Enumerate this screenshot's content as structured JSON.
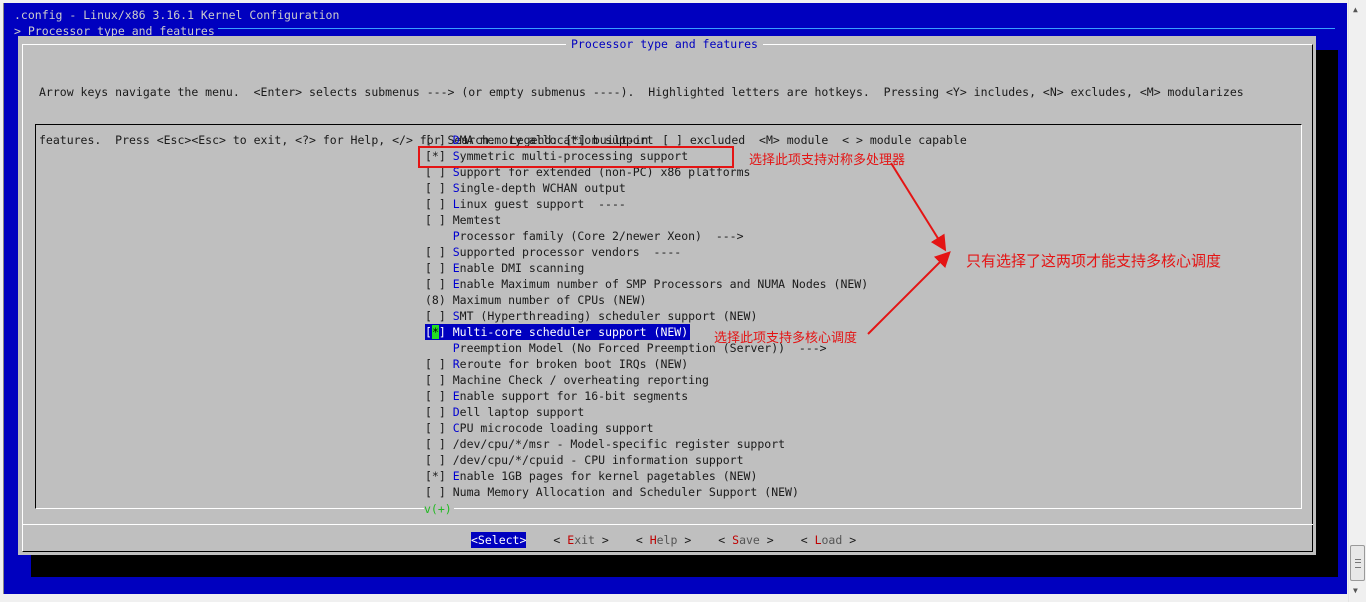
{
  "window": {
    "title": ".config - Linux/x86 3.16.1 Kernel Configuration",
    "breadcrumb": "> Processor type and features "
  },
  "dialog": {
    "title": "Processor type and features",
    "help_lines": [
      "Arrow keys navigate the menu.  <Enter> selects submenus ---> (or empty submenus ----).  Highlighted letters are hotkeys.  Pressing <Y> includes, <N> excludes, <M> modularizes",
      "features.  Press <Esc><Esc> to exit, <?> for Help, </> for Search.  Legend: [*] built-in  [ ] excluded  <M> module  < > module capable"
    ]
  },
  "menu": {
    "items": [
      {
        "state": "[ ]",
        "hotkey": "D",
        "rest": "MA memory allocation support",
        "selected": false
      },
      {
        "state": "[*]",
        "hotkey": "S",
        "rest": "ymmetric multi-processing support",
        "selected": false
      },
      {
        "state": "[ ]",
        "hotkey": "S",
        "rest": "upport for extended (non-PC) x86 platforms",
        "selected": false
      },
      {
        "state": "[ ]",
        "hotkey": "S",
        "rest": "ingle-depth WCHAN output",
        "selected": false
      },
      {
        "state": "[ ]",
        "hotkey": "L",
        "rest": "inux guest support  ----",
        "selected": false
      },
      {
        "state": "[ ]",
        "hotkey": "",
        "rest": "Memtest",
        "selected": false
      },
      {
        "state": "   ",
        "hotkey": "P",
        "rest": "rocessor family (Core 2/newer Xeon)  --->",
        "selected": false
      },
      {
        "state": "[ ]",
        "hotkey": "S",
        "rest": "upported processor vendors  ----",
        "selected": false
      },
      {
        "state": "[ ]",
        "hotkey": "E",
        "rest": "nable DMI scanning",
        "selected": false
      },
      {
        "state": "[ ]",
        "hotkey": "E",
        "rest": "nable Maximum number of SMP Processors and NUMA Nodes (NEW)",
        "selected": false
      },
      {
        "state": "(8)",
        "hotkey": "",
        "rest": "Maximum number of CPUs (NEW)",
        "selected": false
      },
      {
        "state": "[ ]",
        "hotkey": "S",
        "rest": "MT (Hyperthreading) scheduler support (NEW)",
        "selected": false
      },
      {
        "state": "[*]",
        "hotkey": "",
        "rest": "Multi-core scheduler support (NEW)",
        "selected": true
      },
      {
        "state": "   ",
        "hotkey": "P",
        "rest": "reemption Model (No Forced Preemption (Server))  --->",
        "selected": false
      },
      {
        "state": "[ ]",
        "hotkey": "R",
        "rest": "eroute for broken boot IRQs (NEW)",
        "selected": false
      },
      {
        "state": "[ ]",
        "hotkey": "",
        "rest": "Machine Check / overheating reporting",
        "selected": false
      },
      {
        "state": "[ ]",
        "hotkey": "E",
        "rest": "nable support for 16-bit segments",
        "selected": false
      },
      {
        "state": "[ ]",
        "hotkey": "D",
        "rest": "ell laptop support",
        "selected": false
      },
      {
        "state": "[ ]",
        "hotkey": "C",
        "rest": "PU microcode loading support",
        "selected": false
      },
      {
        "state": "[ ]",
        "hotkey": "",
        "rest": "/dev/cpu/*/msr - Model-specific register support",
        "selected": false
      },
      {
        "state": "[ ]",
        "hotkey": "",
        "rest": "/dev/cpu/*/cpuid - CPU information support",
        "selected": false
      },
      {
        "state": "[*]",
        "hotkey": "E",
        "rest": "nable 1GB pages for kernel pagetables (NEW)",
        "selected": false
      },
      {
        "state": "[ ]",
        "hotkey": "",
        "rest": "Numa Memory Allocation and Scheduler Support (NEW)",
        "selected": false
      }
    ],
    "more_indicator": "v(+)"
  },
  "buttons": [
    {
      "label": "<Select>",
      "active": true
    },
    {
      "pre": "< ",
      "hotkey": "E",
      "rest": "xit",
      "post": " >",
      "active": false
    },
    {
      "pre": "< ",
      "hotkey": "H",
      "rest": "elp",
      "post": " >",
      "active": false
    },
    {
      "pre": "< ",
      "hotkey": "S",
      "rest": "ave",
      "post": " >",
      "active": false
    },
    {
      "pre": "< ",
      "hotkey": "L",
      "rest": "oad",
      "post": " >",
      "active": false
    }
  ],
  "annotations": {
    "smp_note": "选择此项支持对称多处理器",
    "summary_note": "只有选择了这两项才能支持多核心调度",
    "multicore_note": "选择此项支持多核心调度",
    "color": "#e41414"
  },
  "colors": {
    "terminal_bg": "#0000bf",
    "dialog_bg": "#bfbfbf",
    "hotkey": "#0000d0",
    "button_hotkey": "#bf0000",
    "cursor": "#22dd22"
  }
}
